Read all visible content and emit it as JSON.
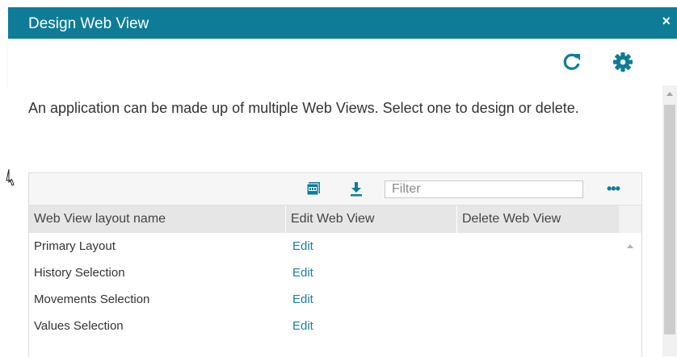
{
  "dialog": {
    "title": "Design Web View",
    "close_label": "×"
  },
  "toolbar": {
    "refresh_icon": "refresh-icon",
    "settings_icon": "gear-icon"
  },
  "intro_text": "An application can be made up of multiple Web Views. Select one to design or delete.",
  "grid": {
    "filter_placeholder": "Filter",
    "more_label": "•••",
    "columns": [
      "Web View layout name",
      "Edit Web View",
      "Delete Web View"
    ],
    "rows": [
      {
        "name": "Primary Layout",
        "edit": "Edit"
      },
      {
        "name": "History Selection",
        "edit": "Edit"
      },
      {
        "name": "Movements Selection",
        "edit": "Edit"
      },
      {
        "name": "Values Selection",
        "edit": "Edit"
      }
    ]
  },
  "colors": {
    "titlebar": "#0e7c97",
    "accent": "#0e7c97",
    "link": "#1a7fa0"
  }
}
